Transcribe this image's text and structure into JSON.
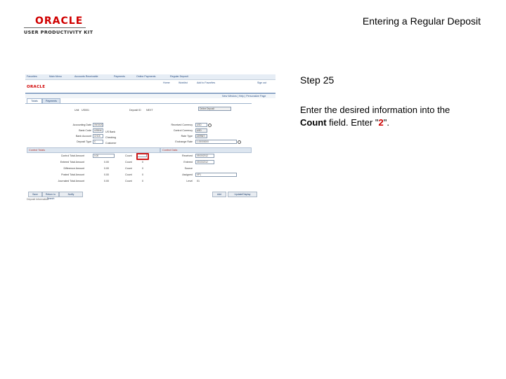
{
  "slide": {
    "logo_word": "ORACLE",
    "logo_sub": "USER PRODUCTIVITY KIT",
    "title": "Entering a Regular Deposit"
  },
  "instructions": {
    "step": "Step 25",
    "text_before": "Enter the desired information into the ",
    "field_name": "Count",
    "text_middle": " field. Enter \"",
    "value": "2",
    "text_after": "\"."
  },
  "screenshot": {
    "nav_items": [
      "Favorites",
      "Main Menu",
      "Accounts Receivable",
      "Payments",
      "Online Payments",
      "Regular Deposit"
    ],
    "ps_logo": "ORACLE",
    "top_links": [
      "Home",
      "Worklist",
      "Add to Favorites",
      "Sign out"
    ],
    "window_links": [
      "New Window",
      "Help",
      "Personalize Page"
    ],
    "tabs": [
      "Totals",
      "Payments"
    ],
    "unit_label": "Unit",
    "unit_value": "US001",
    "deposit_id_label": "Deposit ID",
    "deposit_id_value": "NEXT",
    "entry_status": "Online Deposit",
    "fields_left": [
      {
        "label": "Accounting Date",
        "value": "09/15/2012"
      },
      {
        "label": "Bank Code",
        "value": "USBNK"
      },
      {
        "label": "Bank Account",
        "value": "CHCK"
      },
      {
        "label": "Deposit Type",
        "value": "C"
      }
    ],
    "fields_left_desc": [
      "US Bank",
      "Checking",
      "Customer"
    ],
    "fields_right": [
      {
        "label": "Received Currency",
        "value": "USD"
      },
      {
        "label": "Control Currency",
        "value": "USD"
      },
      {
        "label": "Rate Type",
        "value": "CRRNT"
      },
      {
        "label": "Exchange Rate",
        "value": "1.00000000"
      }
    ],
    "control_totals_header": "Control Totals",
    "control_totals": [
      {
        "label": "Control Total Amount",
        "value": "0.00",
        "count_label": "Count",
        "count_value": ""
      },
      {
        "label": "Entered Total Amount",
        "value": "0.00",
        "count_label": "Count",
        "count_value": "0"
      },
      {
        "label": "Difference Amount",
        "value": "0.00",
        "count_label": "Count",
        "count_value": "0"
      },
      {
        "label": "Posted Total Amount",
        "value": "0.00",
        "count_label": "Count",
        "count_value": "0"
      },
      {
        "label": "Journaled Total Amount",
        "value": "0.00",
        "count_label": "Count",
        "count_value": "0"
      }
    ],
    "control_data_header": "Control Data",
    "control_data": [
      {
        "label": "Received",
        "value": "09/15/2012"
      },
      {
        "label": "Entered",
        "value": "09/15/2012"
      },
      {
        "label": "Source",
        "value": ""
      },
      {
        "label": "Assigned",
        "value": "VP1"
      },
      {
        "label": "Level",
        "value": "01"
      }
    ],
    "buttons_left": [
      "Save",
      "Return to Search",
      "Notify"
    ],
    "buttons_right": [
      "Add",
      "Update/Display"
    ],
    "footer_note": "Deposit Information"
  }
}
